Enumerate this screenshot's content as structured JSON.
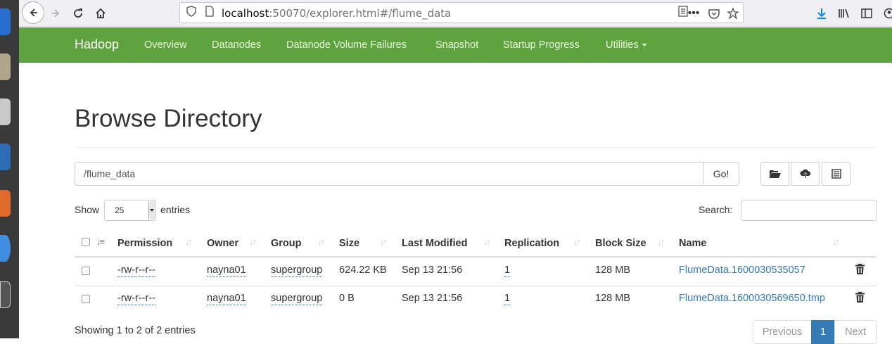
{
  "browser": {
    "url_host": "localhost",
    "url_rest": ":50070/explorer.html#/flume_data"
  },
  "navbar": {
    "brand": "Hadoop",
    "items": [
      "Overview",
      "Datanodes",
      "Datanode Volume Failures",
      "Snapshot",
      "Startup Progress",
      "Utilities"
    ]
  },
  "page": {
    "title": "Browse Directory",
    "path_value": "/flume_data",
    "go_label": "Go!",
    "show_label": "Show",
    "entries_value": "25",
    "entries_label": "entries",
    "search_label": "Search:"
  },
  "table": {
    "headers": [
      "Permission",
      "Owner",
      "Group",
      "Size",
      "Last Modified",
      "Replication",
      "Block Size",
      "Name"
    ],
    "rows": [
      {
        "permission": "-rw-r--r--",
        "owner": "nayna01",
        "group": "supergroup",
        "size": "624.22 KB",
        "modified": "Sep 13 21:56",
        "replication": "1",
        "block_size": "128 MB",
        "name": "FlumeData.1600030535057"
      },
      {
        "permission": "-rw-r--r--",
        "owner": "nayna01",
        "group": "supergroup",
        "size": "0 B",
        "modified": "Sep 13 21:56",
        "replication": "1",
        "block_size": "128 MB",
        "name": "FlumeData.1600030569650.tmp"
      }
    ]
  },
  "footer": {
    "info": "Showing 1 to 2 of 2 entries",
    "previous": "Previous",
    "current_page": "1",
    "next": "Next"
  },
  "colors": {
    "navbar": "#5fa33e",
    "link": "#337ab7",
    "active_page": "#337ab7"
  },
  "icons": [
    "back-icon",
    "forward-icon",
    "reload-icon",
    "home-icon",
    "shield-icon",
    "page-icon",
    "reader-view-icon",
    "more-icon",
    "pocket-icon",
    "bookmark-star-icon",
    "download-icon",
    "library-icon",
    "sidebar-icon",
    "account-icon",
    "folder-open-icon",
    "upload-icon",
    "list-icon",
    "sort-icon",
    "trash-icon"
  ]
}
